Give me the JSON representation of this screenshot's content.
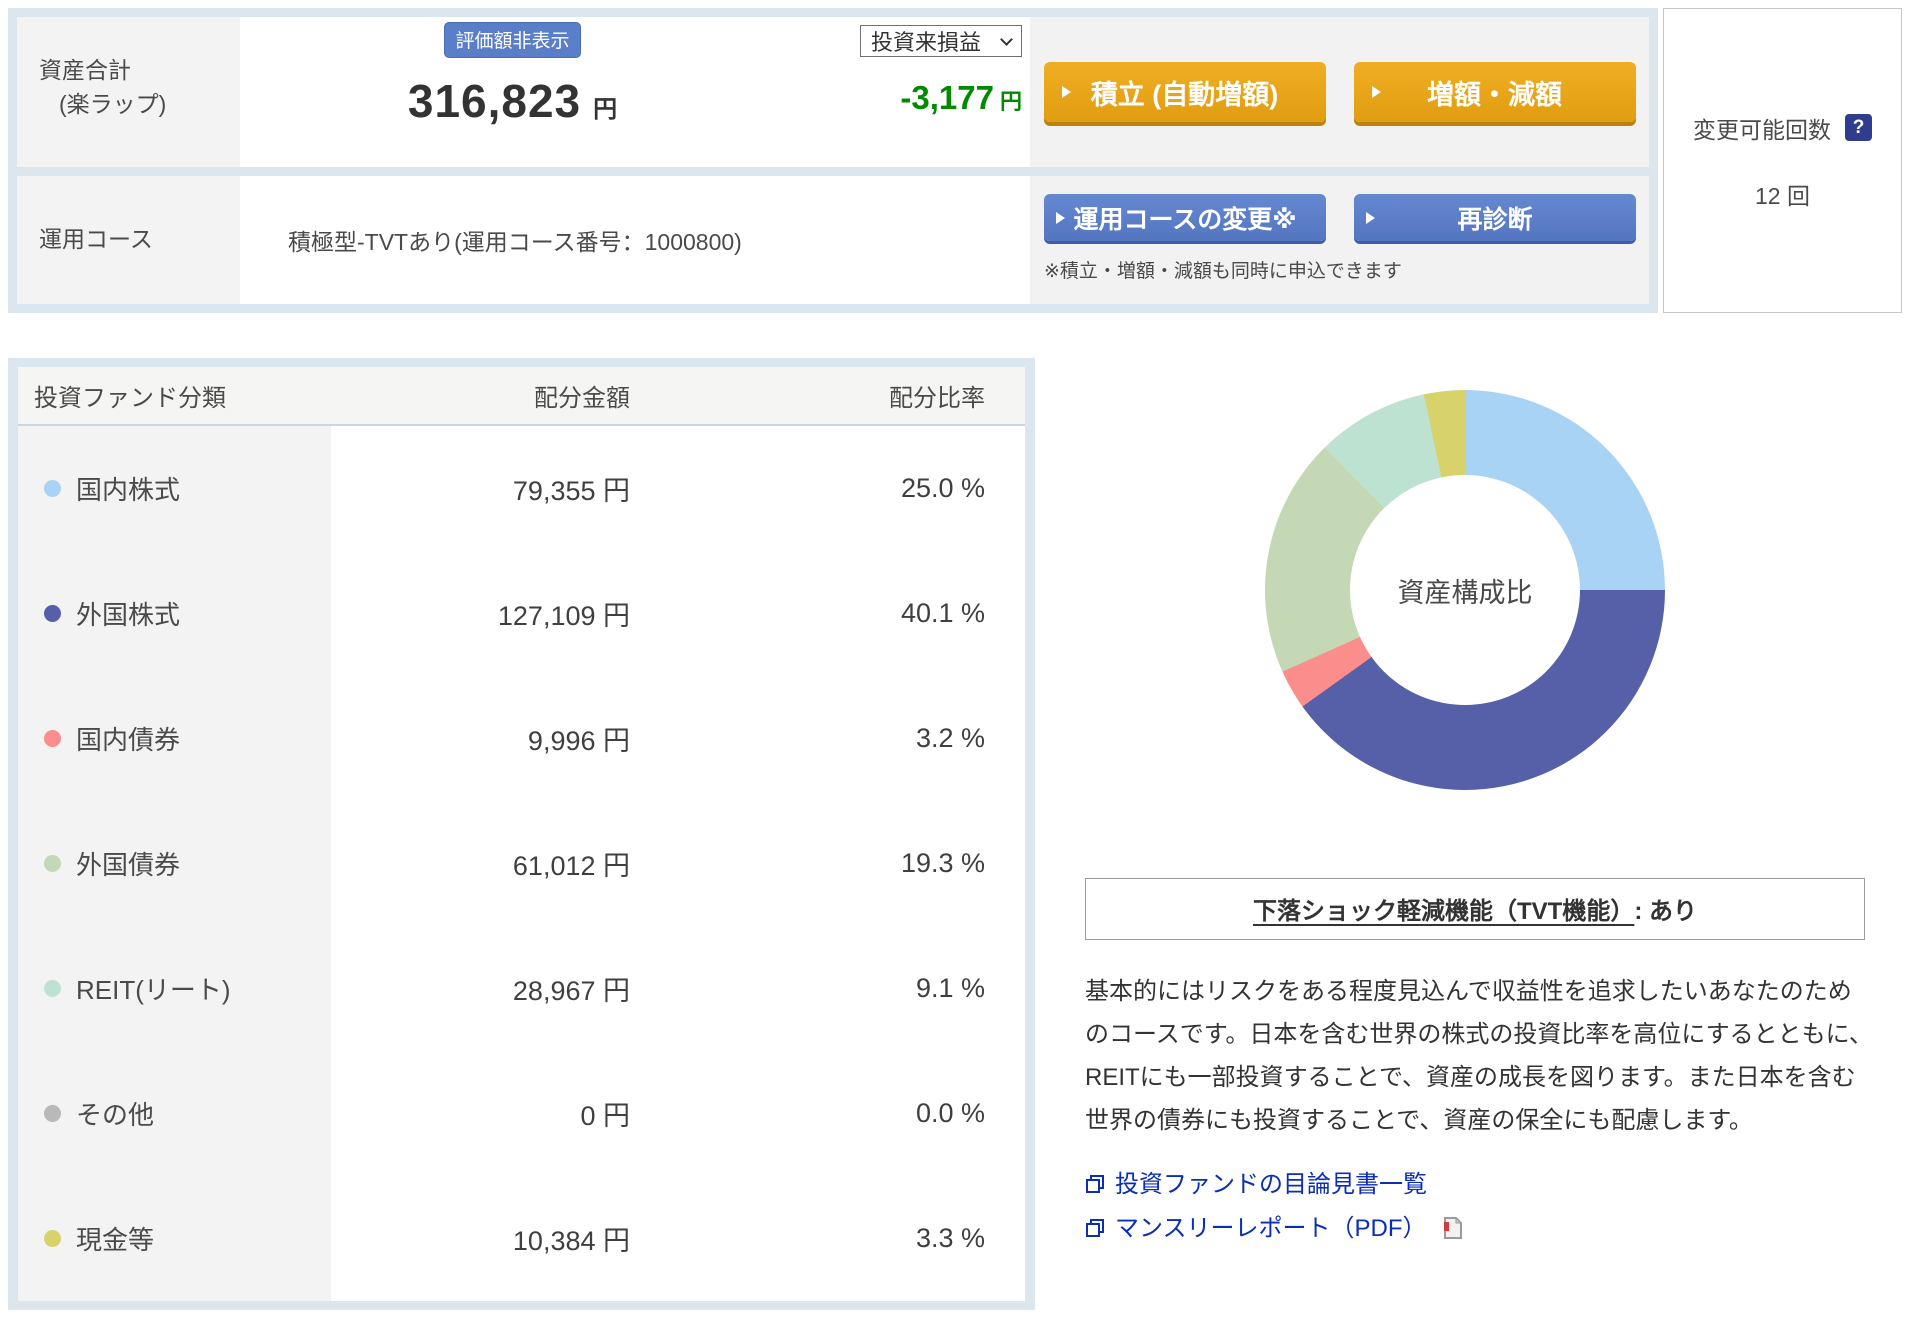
{
  "summary": {
    "asset_total_label": "資産合計",
    "asset_total_sublabel": "(楽ラップ)",
    "hide_value_badge": "評価額非表示",
    "total_amount": "316,823",
    "total_unit": "円",
    "pl_select_value": "投資来損益",
    "pl_amount": "-3,177",
    "pl_unit": "円",
    "pl_color": "#008a00",
    "course_label": "運用コース",
    "course_value": "積極型-TVTあり(運用コース番号：1000800)",
    "buttons": {
      "tsumitate": "積立 (自動増額)",
      "zogaku": "増額・減額",
      "course_change": "運用コースの変更※",
      "rediagnosis": "再診断"
    },
    "note": "※積立・増額・減額も同時に申込できます",
    "change_count_label": "変更可能回数",
    "change_count_value": "12 回",
    "accent_orange": "#e8a41c",
    "accent_blue": "#5b7ec9"
  },
  "table": {
    "header": [
      "投資ファンド分類",
      "配分金額",
      "配分比率"
    ],
    "rows": [
      {
        "label": "国内株式",
        "amount": "79,355 円",
        "ratio": "25.0 %",
        "color": "#a8d3f4"
      },
      {
        "label": "外国株式",
        "amount": "127,109 円",
        "ratio": "40.1 %",
        "color": "#5560a8"
      },
      {
        "label": "国内債券",
        "amount": "9,996 円",
        "ratio": "3.2 %",
        "color": "#fc8d8d"
      },
      {
        "label": "外国債券",
        "amount": "61,012 円",
        "ratio": "19.3 %",
        "color": "#c5d8b5"
      },
      {
        "label": "REIT(リート)",
        "amount": "28,967 円",
        "ratio": "9.1 %",
        "color": "#bee2d2"
      },
      {
        "label": "その他",
        "amount": "0 円",
        "ratio": "0.0 %",
        "color": "#b9b9b9"
      },
      {
        "label": "現金等",
        "amount": "10,384 円",
        "ratio": "3.3 %",
        "color": "#d8d26b"
      }
    ]
  },
  "chart_data": {
    "type": "pie",
    "donut": true,
    "title": "資産構成比",
    "labels": [
      "国内株式",
      "外国株式",
      "国内債券",
      "外国債券",
      "REIT(リート)",
      "その他",
      "現金等"
    ],
    "values": [
      25.0,
      40.1,
      3.2,
      19.3,
      9.1,
      0.0,
      3.3
    ],
    "colors": [
      "#a8d3f4",
      "#5560a8",
      "#fc8d8d",
      "#c5d8b5",
      "#bee2d2",
      "#b9b9b9",
      "#d8d26b"
    ],
    "start_angle_deg": 0,
    "direction": "clockwise"
  },
  "tvt": {
    "underlined": "下落ショック軽減機能（TVT機能）",
    "suffix": ": あり"
  },
  "description": "基本的にはリスクをある程度見込んで収益性を追求したいあなたのためのコースです。日本を含む世界の株式の投資比率を高位にするとともに、REITにも一部投資することで、資産の成長を図ります。また日本を含む世界の債券にも投資することで、資産の保全にも配慮します。",
  "links": {
    "prospectus": "投資ファンドの目論見書一覧",
    "monthly_report": "マンスリーレポート（PDF）"
  }
}
